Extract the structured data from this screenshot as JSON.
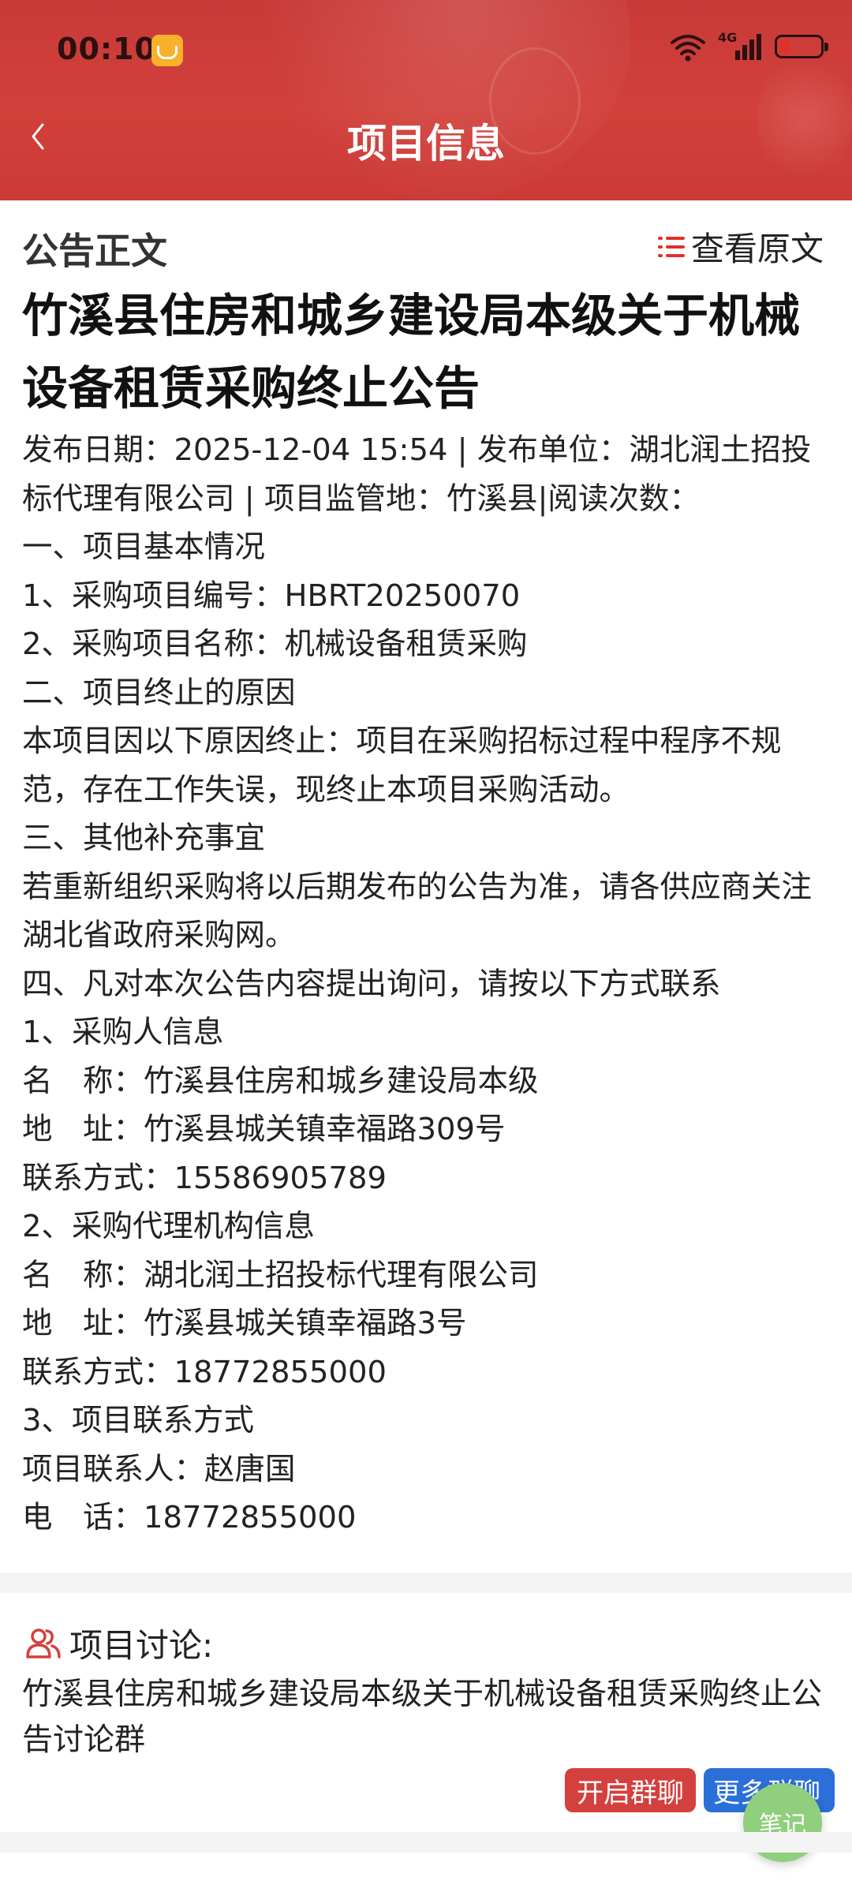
{
  "status_bar": {
    "time": "00:10",
    "network": "4G"
  },
  "header": {
    "title": "项目信息"
  },
  "article": {
    "section_label": "公告正文",
    "view_original": "查看原文",
    "title": "竹溪县住房和城乡建设局本级关于机械设备租赁采购终止公告",
    "meta": "发布日期：2025-12-04 15:54 | 发布单位：湖北润土招投标代理有限公司 | 项目监管地：竹溪县|阅读次数：",
    "lines": [
      "一、项目基本情况",
      "1、采购项目编号：HBRT20250070",
      "2、采购项目名称：机械设备租赁采购",
      "二、项目终止的原因",
      "本项目因以下原因终止：项目在采购招标过程中程序不规范，存在工作失误，现终止本项目采购活动。",
      "三、其他补充事宜",
      "若重新组织采购将以后期发布的公告为准，请各供应商关注湖北省政府采购网。",
      "四、凡对本次公告内容提出询问，请按以下方式联系",
      "1、采购人信息",
      "名　称：竹溪县住房和城乡建设局本级",
      "地　址：竹溪县城关镇幸福路309号",
      "联系方式：15586905789",
      "2、采购代理机构信息",
      "名　称：湖北润土招投标代理有限公司",
      "地　址：竹溪县城关镇幸福路3号",
      "联系方式：18772855000",
      "3、项目联系方式",
      "项目联系人：赵唐国",
      "电　话：18772855000"
    ]
  },
  "discussion": {
    "label": "项目讨论:",
    "group_name": "竹溪县住房和城乡建设局本级关于机械设备租赁采购终止公告讨论群",
    "open_button": "开启群聊",
    "more_button": "更多群聊"
  },
  "fab": {
    "label": "笔记"
  },
  "colors": {
    "accent": "#d2403b",
    "blue": "#2b6fd9",
    "fab": "#8fcf7d"
  }
}
